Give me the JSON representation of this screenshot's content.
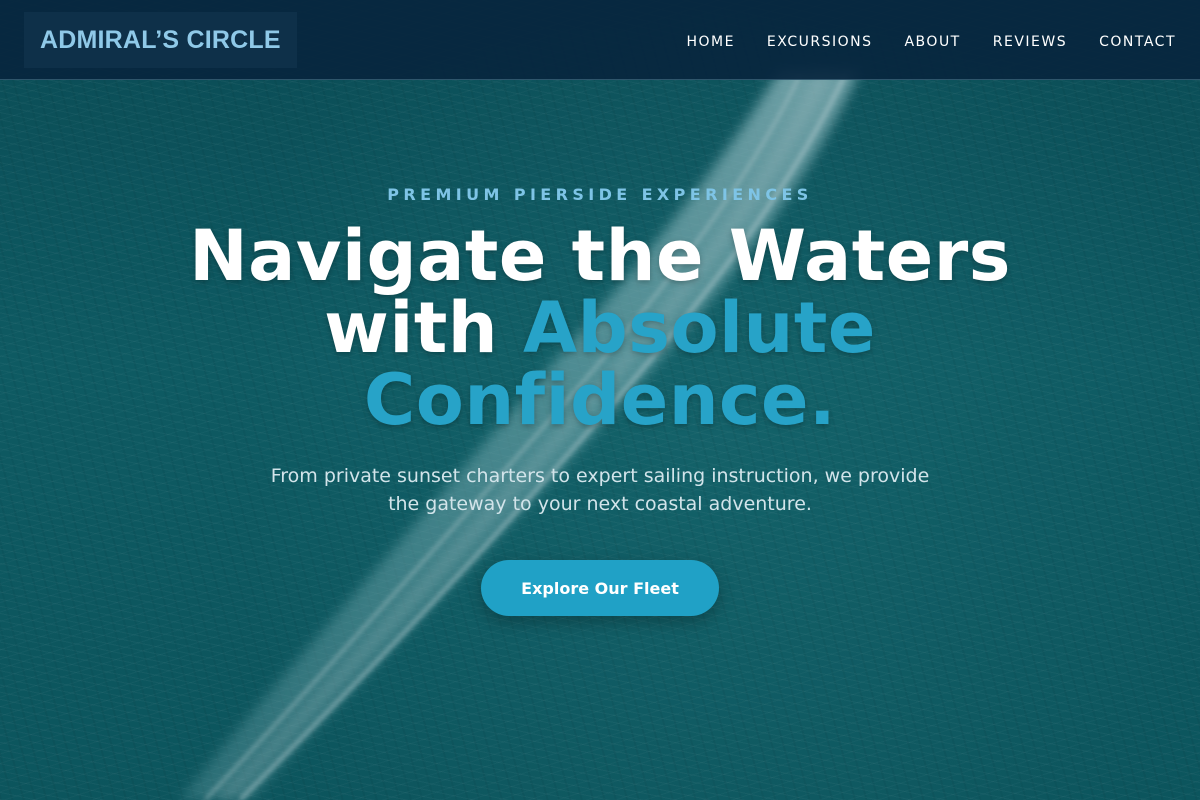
{
  "header": {
    "logo": "ADMIRAL’S CIRCLE",
    "nav": [
      {
        "label": "HOME"
      },
      {
        "label": "EXCURSIONS"
      },
      {
        "label": "ABOUT"
      },
      {
        "label": "REVIEWS"
      },
      {
        "label": "CONTACT"
      }
    ]
  },
  "hero": {
    "eyebrow": "PREMIUM PIERSIDE EXPERIENCES",
    "headline_line1": "Navigate the Waters",
    "headline_with": "with ",
    "headline_accent_1": "Absolute",
    "headline_accent_2": "Confidence.",
    "subtitle": "From private sunset charters to expert sailing instruction, we provide the gateway to your next coastal adventure.",
    "cta_label": "Explore Our Fleet"
  },
  "colors": {
    "header_bg": "#08263e",
    "logo_text": "#8fc9e8",
    "accent": "#27a3c8",
    "cta_bg": "#20a1c6",
    "eyebrow": "#7ec4e6",
    "ocean": "#0f5a62"
  }
}
